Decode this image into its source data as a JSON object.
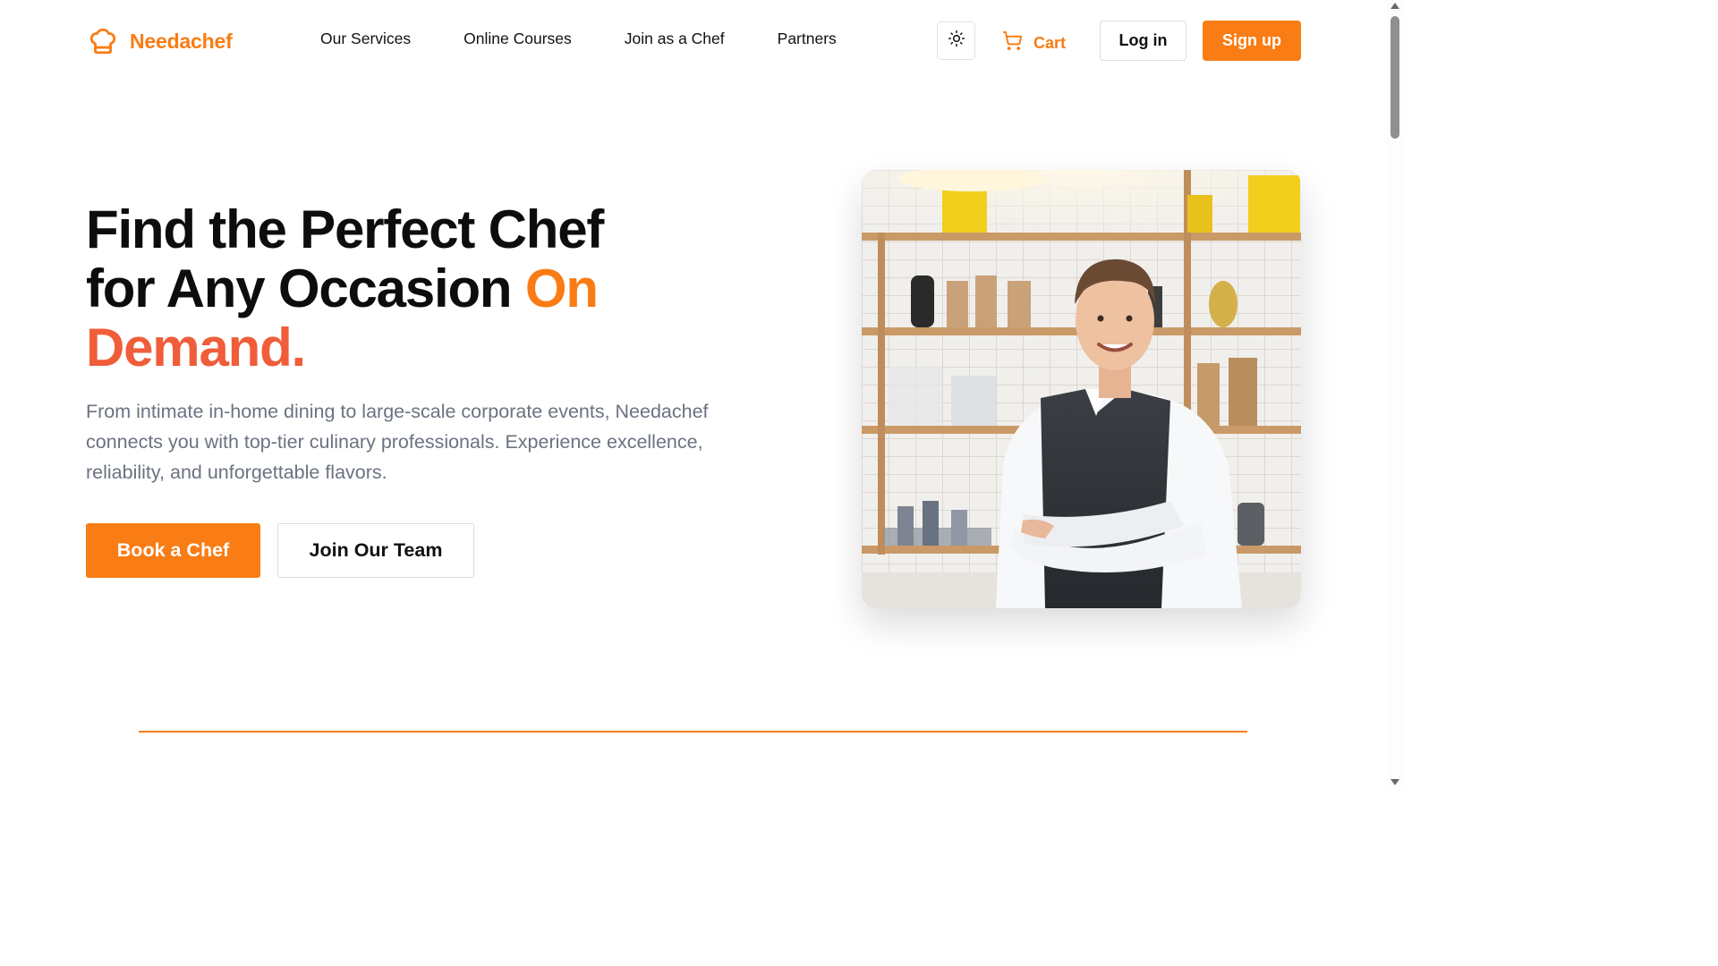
{
  "brand": {
    "name": "Needachef",
    "icon": "chef-hat-icon",
    "color": "#f97c14"
  },
  "nav": {
    "items": [
      "Our Services",
      "Online Courses",
      "Join as a Chef",
      "Partners"
    ]
  },
  "header": {
    "theme_icon": "sun-icon",
    "cart_icon": "cart-icon",
    "cart_label": "Cart",
    "login_label": "Log in",
    "signup_label": "Sign up"
  },
  "hero": {
    "title_line1": "Find the Perfect Chef",
    "title_line2": "for Any Occasion",
    "title_accent1": "On",
    "title_accent2": "Demand.",
    "description": "From intimate in-home dining to large-scale corporate events, Needachef connects you with top-tier culinary professionals. Experience excellence, reliability, and unforgettable flavors.",
    "primary_cta": "Book a Chef",
    "secondary_cta": "Join Our Team",
    "accent_color_1": "#f97c14",
    "accent_color_2": "#f05d3a"
  }
}
